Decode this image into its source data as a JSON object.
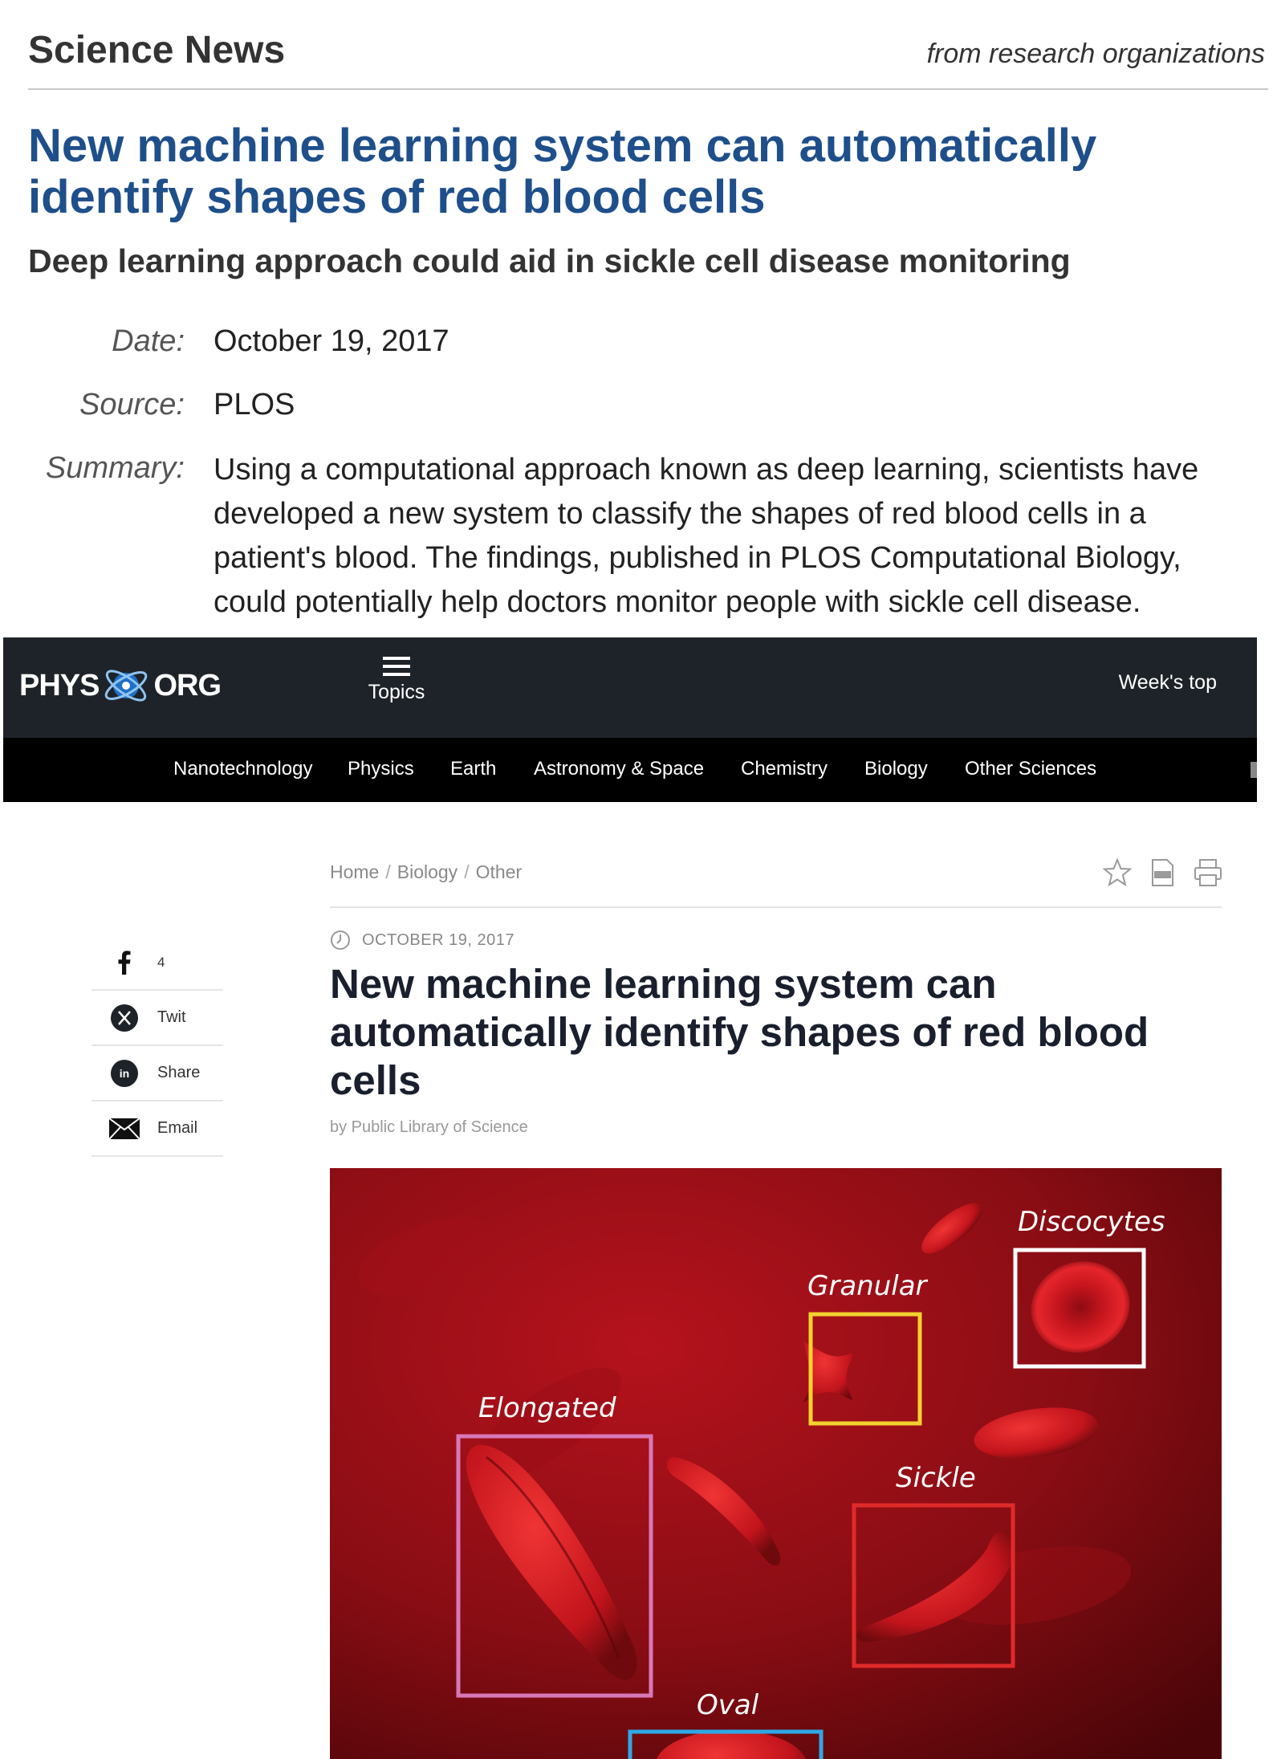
{
  "science_news": {
    "brand": "Science News",
    "tagline": "from research organizations",
    "title": "New machine learning system can automatically identify shapes of red blood cells",
    "subtitle": "Deep learning approach could aid in sickle cell disease monitoring",
    "date_label": "Date:",
    "date_value": "October 19, 2017",
    "source_label": "Source:",
    "source_value": "PLOS",
    "summary_label": "Summary:",
    "summary_value": "Using a computational approach known as deep learning, scientists have developed a new system to classify the shapes of red blood cells in a patient's blood. The findings, published in PLOS Computational Biology, could potentially help doctors monitor people with sickle cell disease."
  },
  "phys": {
    "logo_left": "PHYS",
    "logo_right": "ORG",
    "topics_label": "Topics",
    "weeks_top_label": "Week's top",
    "nav": [
      "Nanotechnology",
      "Physics",
      "Earth",
      "Astronomy & Space",
      "Chemistry",
      "Biology",
      "Other Sciences"
    ]
  },
  "article": {
    "breadcrumb": [
      "Home",
      "Biology",
      "Other"
    ],
    "date": "OCTOBER 19, 2017",
    "title": "New machine learning system can automatically identify shapes of red blood cells",
    "byline": "by Public Library of Science",
    "share": {
      "facebook_count": "4",
      "twit_label": "Twit",
      "share_label": "Share",
      "email_label": "Email"
    },
    "figure_labels": {
      "discocytes": "Discocytes",
      "granular": "Granular",
      "elongated": "Elongated",
      "sickle": "Sickle",
      "oval": "Oval"
    }
  },
  "colors": {
    "title_blue": "#1f4f8b",
    "phys_header": "#1e2329",
    "nav_bg": "#000000",
    "box_white": "#ffffff",
    "box_yellow": "#f2d22e",
    "box_pink": "#d878b8",
    "box_red": "#e02a2a",
    "box_blue": "#2ea8e6"
  }
}
